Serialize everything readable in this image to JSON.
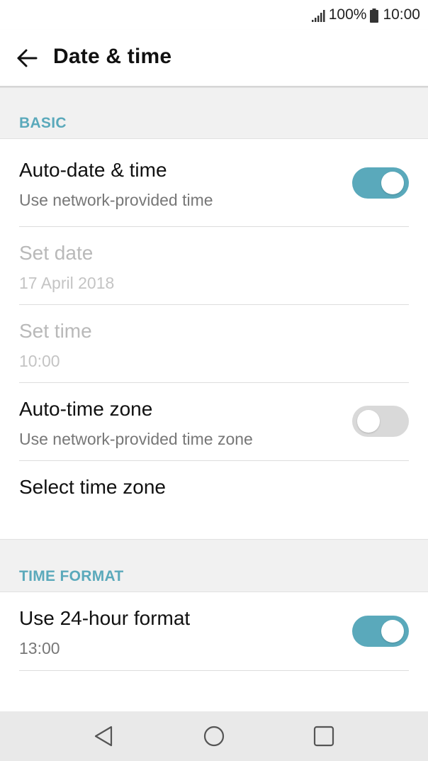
{
  "status_bar": {
    "battery_percent": "100%",
    "time": "10:00",
    "signal_icon": "signal-icon",
    "battery_icon": "battery-icon"
  },
  "app_bar": {
    "title": "Date & time",
    "back_icon": "arrow-back-icon"
  },
  "sections": {
    "basic": {
      "header": "BASIC",
      "auto_date_time": {
        "title": "Auto-date & time",
        "summary": "Use network-provided time",
        "enabled": true
      },
      "set_date": {
        "title": "Set date",
        "summary": "17 April 2018"
      },
      "set_time": {
        "title": "Set time",
        "summary": "10:00"
      },
      "auto_time_zone": {
        "title": "Auto-time zone",
        "summary": "Use network-provided time zone",
        "enabled": false
      },
      "select_time_zone": {
        "title": "Select time zone"
      }
    },
    "time_format": {
      "header": "TIME FORMAT",
      "use_24_hour": {
        "title": "Use 24-hour format",
        "summary": "13:00",
        "enabled": true
      }
    }
  },
  "nav_bar": {
    "back_icon": "nav-back-icon",
    "home_icon": "nav-home-icon",
    "recents_icon": "nav-recents-icon"
  },
  "colors": {
    "accent": "#5aa9bb",
    "switch_off": "#d9d9d9",
    "section_bg": "#f1f1f1",
    "nav_bg": "#e9e9e9"
  }
}
